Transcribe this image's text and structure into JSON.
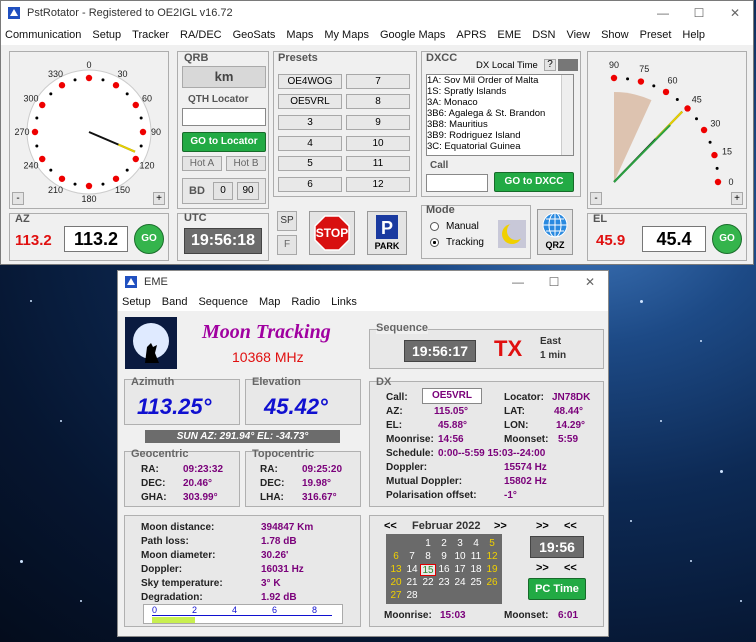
{
  "colors": {
    "accent_green": "#22aa44",
    "red": "#e01010",
    "purple": "#7a007a",
    "blue": "#1010d0"
  },
  "main": {
    "title": "PstRotator - Registered to OE2IGL  v16.72",
    "menu": [
      "Communication",
      "Setup",
      "Tracker",
      "RA/DEC",
      "GeoSats",
      "Maps",
      "My Maps",
      "Google Maps",
      "APRS",
      "EME",
      "DSN",
      "View",
      "Show",
      "Preset",
      "Help"
    ],
    "az": {
      "label": "AZ",
      "current": "113.2",
      "target": "113.2",
      "go": "GO",
      "scale": [
        "0",
        "30",
        "60",
        "90",
        "120",
        "150",
        "180",
        "210",
        "240",
        "270",
        "300",
        "330"
      ],
      "minus": "-",
      "plus": "+"
    },
    "el": {
      "label": "EL",
      "current": "45.9",
      "target": "45.4",
      "go": "GO",
      "scale": [
        "90",
        "75",
        "60",
        "45",
        "30",
        "15",
        "0"
      ],
      "minus": "-",
      "plus": "+"
    },
    "qrb": {
      "label": "QRB",
      "value": "km",
      "qth_label": "QTH Locator",
      "qth_value": "",
      "go_locator": "GO to Locator",
      "hot_a": "Hot A",
      "hot_b": "Hot B",
      "bd": "BD",
      "bd_0": "0",
      "bd_90": "90"
    },
    "utc": {
      "label": "UTC",
      "time": "19:56:18"
    },
    "presets": {
      "label": "Presets",
      "left": [
        "OE4WOG",
        "OE5VRL",
        "3",
        "4",
        "5",
        "6"
      ],
      "right": [
        "7",
        "8",
        "9",
        "10",
        "11",
        "12"
      ]
    },
    "buttons": {
      "sp": "SP",
      "f": "F",
      "stop": "STOP",
      "park": "PARK",
      "qrz": "QRZ"
    },
    "dxcc": {
      "label": "DXCC",
      "local_time_label": "DX Local Time",
      "help": "?",
      "items": [
        "1A:  Sov Mil Order of Malta",
        "1S:  Spratly Islands",
        "3A:  Monaco",
        "3B6:  Agalega & St. Brandon",
        "3B8:  Mauritius",
        "3B9:  Rodriguez Island",
        "3C:  Equatorial Guinea"
      ],
      "call_label": "Call",
      "call_value": "",
      "go_dxcc": "GO to DXCC"
    },
    "mode": {
      "label": "Mode",
      "manual": "Manual",
      "tracking": "Tracking"
    }
  },
  "eme": {
    "title": "EME",
    "menu": [
      "Setup",
      "Band",
      "Sequence",
      "Map",
      "Radio",
      "Links"
    ],
    "header": {
      "title": "Moon Tracking",
      "freq": "10368 MHz"
    },
    "sequence": {
      "label": "Sequence",
      "time": "19:56:17",
      "tx": "TX",
      "east": "East",
      "duration": "1 min"
    },
    "azimuth": {
      "label": "Azimuth",
      "value": "113.25°"
    },
    "elevation": {
      "label": "Elevation",
      "value": "45.42°"
    },
    "sun": "SUN   AZ: 291.94°   EL: -34.73°",
    "geocentric": {
      "label": "Geocentric",
      "rows": [
        [
          "RA:",
          "09:23:32"
        ],
        [
          "DEC:",
          "20.46°"
        ],
        [
          "GHA:",
          "303.99°"
        ]
      ]
    },
    "topocentric": {
      "label": "Topocentric",
      "rows": [
        [
          "RA:",
          "09:25:20"
        ],
        [
          "DEC:",
          "19.98°"
        ],
        [
          "LHA:",
          "316.67°"
        ]
      ]
    },
    "dx": {
      "label": "DX",
      "call_label": "Call:",
      "call": "OE5VRL",
      "locator_label": "Locator:",
      "locator": "JN78DK",
      "az_label": "AZ:",
      "az": "115.05°",
      "lat_label": "LAT:",
      "lat": "48.44°",
      "el_label": "EL:",
      "el": "45.88°",
      "lon_label": "LON:",
      "lon": "14.29°",
      "moonrise_label": "Moonrise:",
      "moonrise": "14:56",
      "moonset_label": "Moonset:",
      "moonset": "5:59",
      "schedule_label": "Schedule:",
      "schedule": "0:00--5:59    15:03--24:00",
      "doppler_label": "Doppler:",
      "doppler": "15574 Hz",
      "mutual_label": "Mutual Doppler:",
      "mutual": "15802 Hz",
      "pol_label": "Polarisation offset:",
      "pol": "-1°"
    },
    "stats": {
      "rows": [
        [
          "Moon distance:",
          "394847 Km"
        ],
        [
          "Path loss:",
          "1.78 dB"
        ],
        [
          "Moon diameter:",
          "30.26'"
        ],
        [
          "Doppler:",
          "16031 Hz"
        ],
        [
          "Sky temperature:",
          "3° K"
        ],
        [
          "Degradation:",
          "1.92 dB"
        ]
      ],
      "scale": [
        "0",
        "2",
        "4",
        "6",
        "8"
      ],
      "degradation_level": 1.92
    },
    "calendar": {
      "prev": "<<",
      "month": "Februar 2022",
      "next": ">>",
      "time_prev": ">>",
      "time_next": "<<",
      "time": "19:56",
      "pc_time": "PC Time",
      "moonrise_label": "Moonrise:",
      "moonrise": "15:03",
      "moonset_label": "Moonset:",
      "moonset": "6:01",
      "days": [
        [
          "",
          "",
          "1",
          "2",
          "3",
          "4",
          "5"
        ],
        [
          "6",
          "7",
          "8",
          "9",
          "10",
          "11",
          "12"
        ],
        [
          "13",
          "14",
          "15",
          "16",
          "17",
          "18",
          "19"
        ],
        [
          "20",
          "21",
          "22",
          "23",
          "24",
          "25",
          "26"
        ],
        [
          "27",
          "28",
          "",
          "",
          "",
          "",
          ""
        ]
      ],
      "today": "15"
    }
  }
}
